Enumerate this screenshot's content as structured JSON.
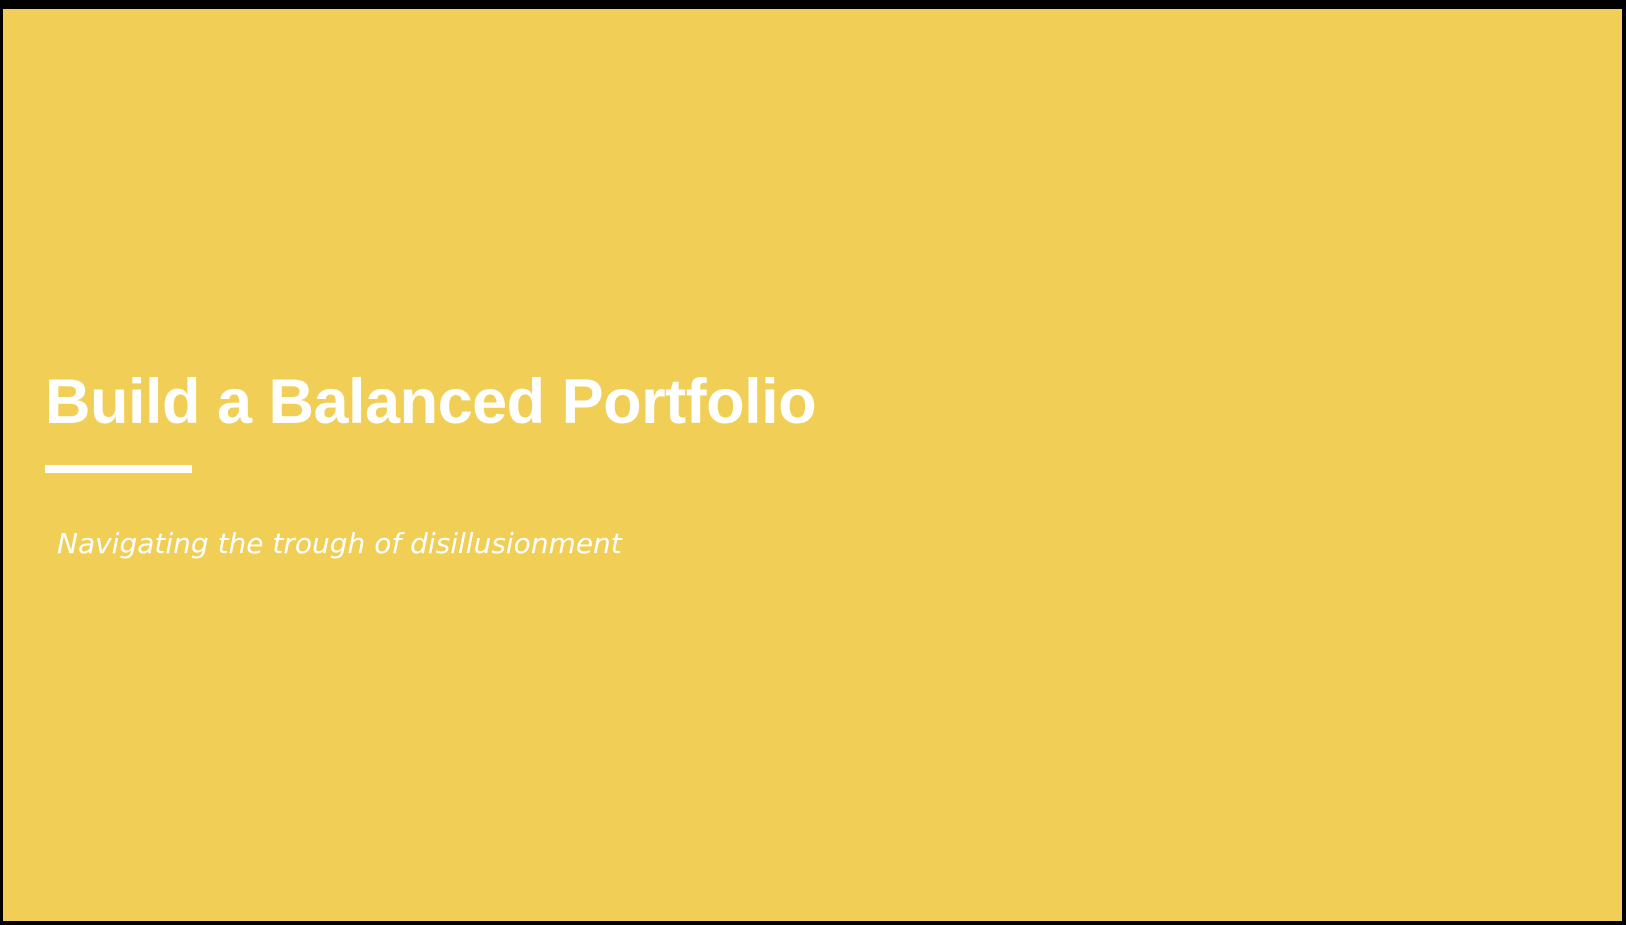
{
  "slide": {
    "title": "Build a Balanced Portfolio",
    "subtitle": "Navigating the trough of disillusionment",
    "background_color": "#F1CE55",
    "text_color": "#FFFFFF"
  }
}
